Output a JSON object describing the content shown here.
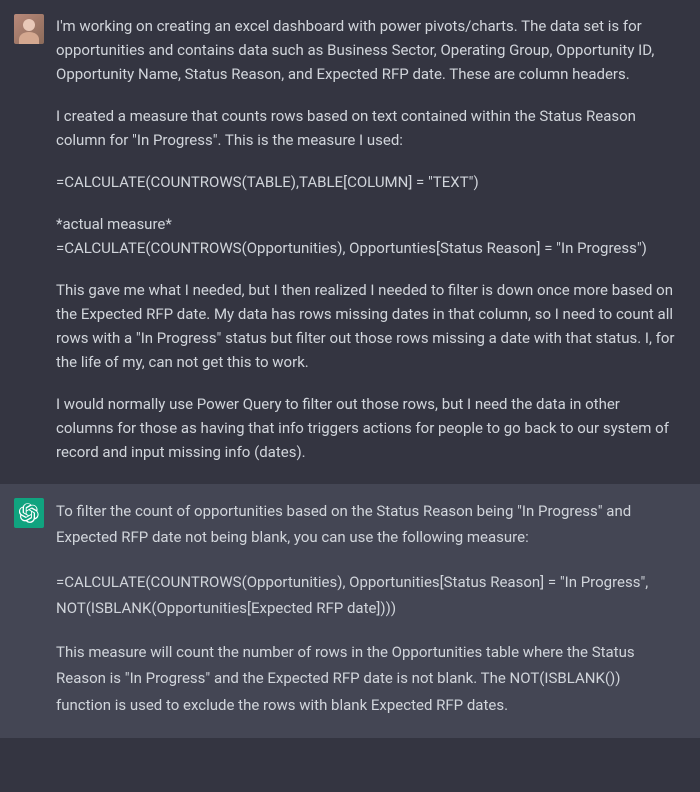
{
  "user": {
    "p1": "I'm working on creating an excel dashboard with power pivots/charts.   The data set is for opportunities and contains data such as Business Sector, Operating Group, Opportunity ID, Opportunity Name, Status Reason, and Expected RFP date.   These are column headers.",
    "p2": "I created a measure that counts rows based on text contained within the Status Reason column for \"In Progress\".  This is the measure I used:",
    "p3": "=CALCULATE(COUNTROWS(TABLE),TABLE[COLUMN] = \"TEXT\")",
    "p4a": "*actual measure*",
    "p4b": "=CALCULATE(COUNTROWS(Opportunities), Opportunties[Status Reason] = \"In Progress\")",
    "p5": "This gave me what I needed, but I then realized I needed to filter is down once more based on the Expected RFP date.   My data has rows missing dates in that column, so I need to count all rows with a \"In Progress\" status but filter out those rows missing a date with that status.  I, for the life of my, can not get this to work.",
    "p6": "I would normally use Power Query to filter out those rows, but I need the data in other columns for those as having that info triggers actions for people to go back to our system of record and input missing info (dates)."
  },
  "assistant": {
    "p1": "To filter the count of opportunities based on the Status Reason being \"In Progress\" and Expected RFP date not being blank, you can use the following measure:",
    "p2": "=CALCULATE(COUNTROWS(Opportunities), Opportunities[Status Reason] = \"In Progress\", NOT(ISBLANK(Opportunities[Expected RFP date])))",
    "p3": "This measure will count the number of rows in the Opportunities table where the Status Reason is \"In Progress\" and the Expected RFP date is not blank. The NOT(ISBLANK()) function is used to exclude the rows with blank Expected RFP dates."
  }
}
